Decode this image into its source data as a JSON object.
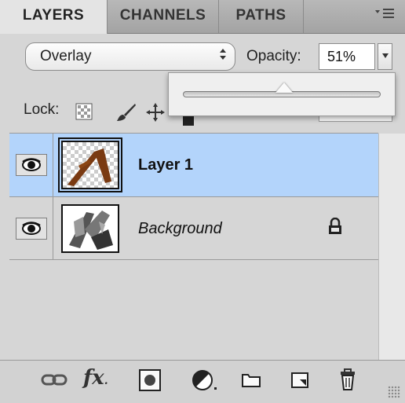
{
  "tabs": [
    {
      "label": "LAYERS",
      "active": true
    },
    {
      "label": "CHANNELS",
      "active": false
    },
    {
      "label": "PATHS",
      "active": false
    }
  ],
  "menu_icon": "panel-menu-icon",
  "blend_mode": {
    "value": "Overlay",
    "arrow": "÷"
  },
  "opacity": {
    "label": "Opacity:",
    "value": "51%",
    "slider_fraction": 0.51
  },
  "lock": {
    "label": "Lock:",
    "icons": [
      "lock-transparent-icon",
      "lock-image-icon",
      "lock-position-icon",
      "lock-all-icon"
    ]
  },
  "layers": [
    {
      "name": "Layer 1",
      "visible": true,
      "selected": true,
      "locked": false,
      "style": "bold"
    },
    {
      "name": "Background",
      "visible": true,
      "selected": false,
      "locked": true,
      "style": "italic"
    }
  ],
  "bottom_icons": [
    "link-layers-icon",
    "fx-icon",
    "add-mask-icon",
    "adjustment-layer-icon",
    "new-group-icon",
    "new-layer-icon",
    "trash-icon"
  ],
  "fx_label": "fx",
  "colors": {
    "selection": "#b3d4fb",
    "panel": "#d6d6d6",
    "brush": "#7a3a12"
  }
}
